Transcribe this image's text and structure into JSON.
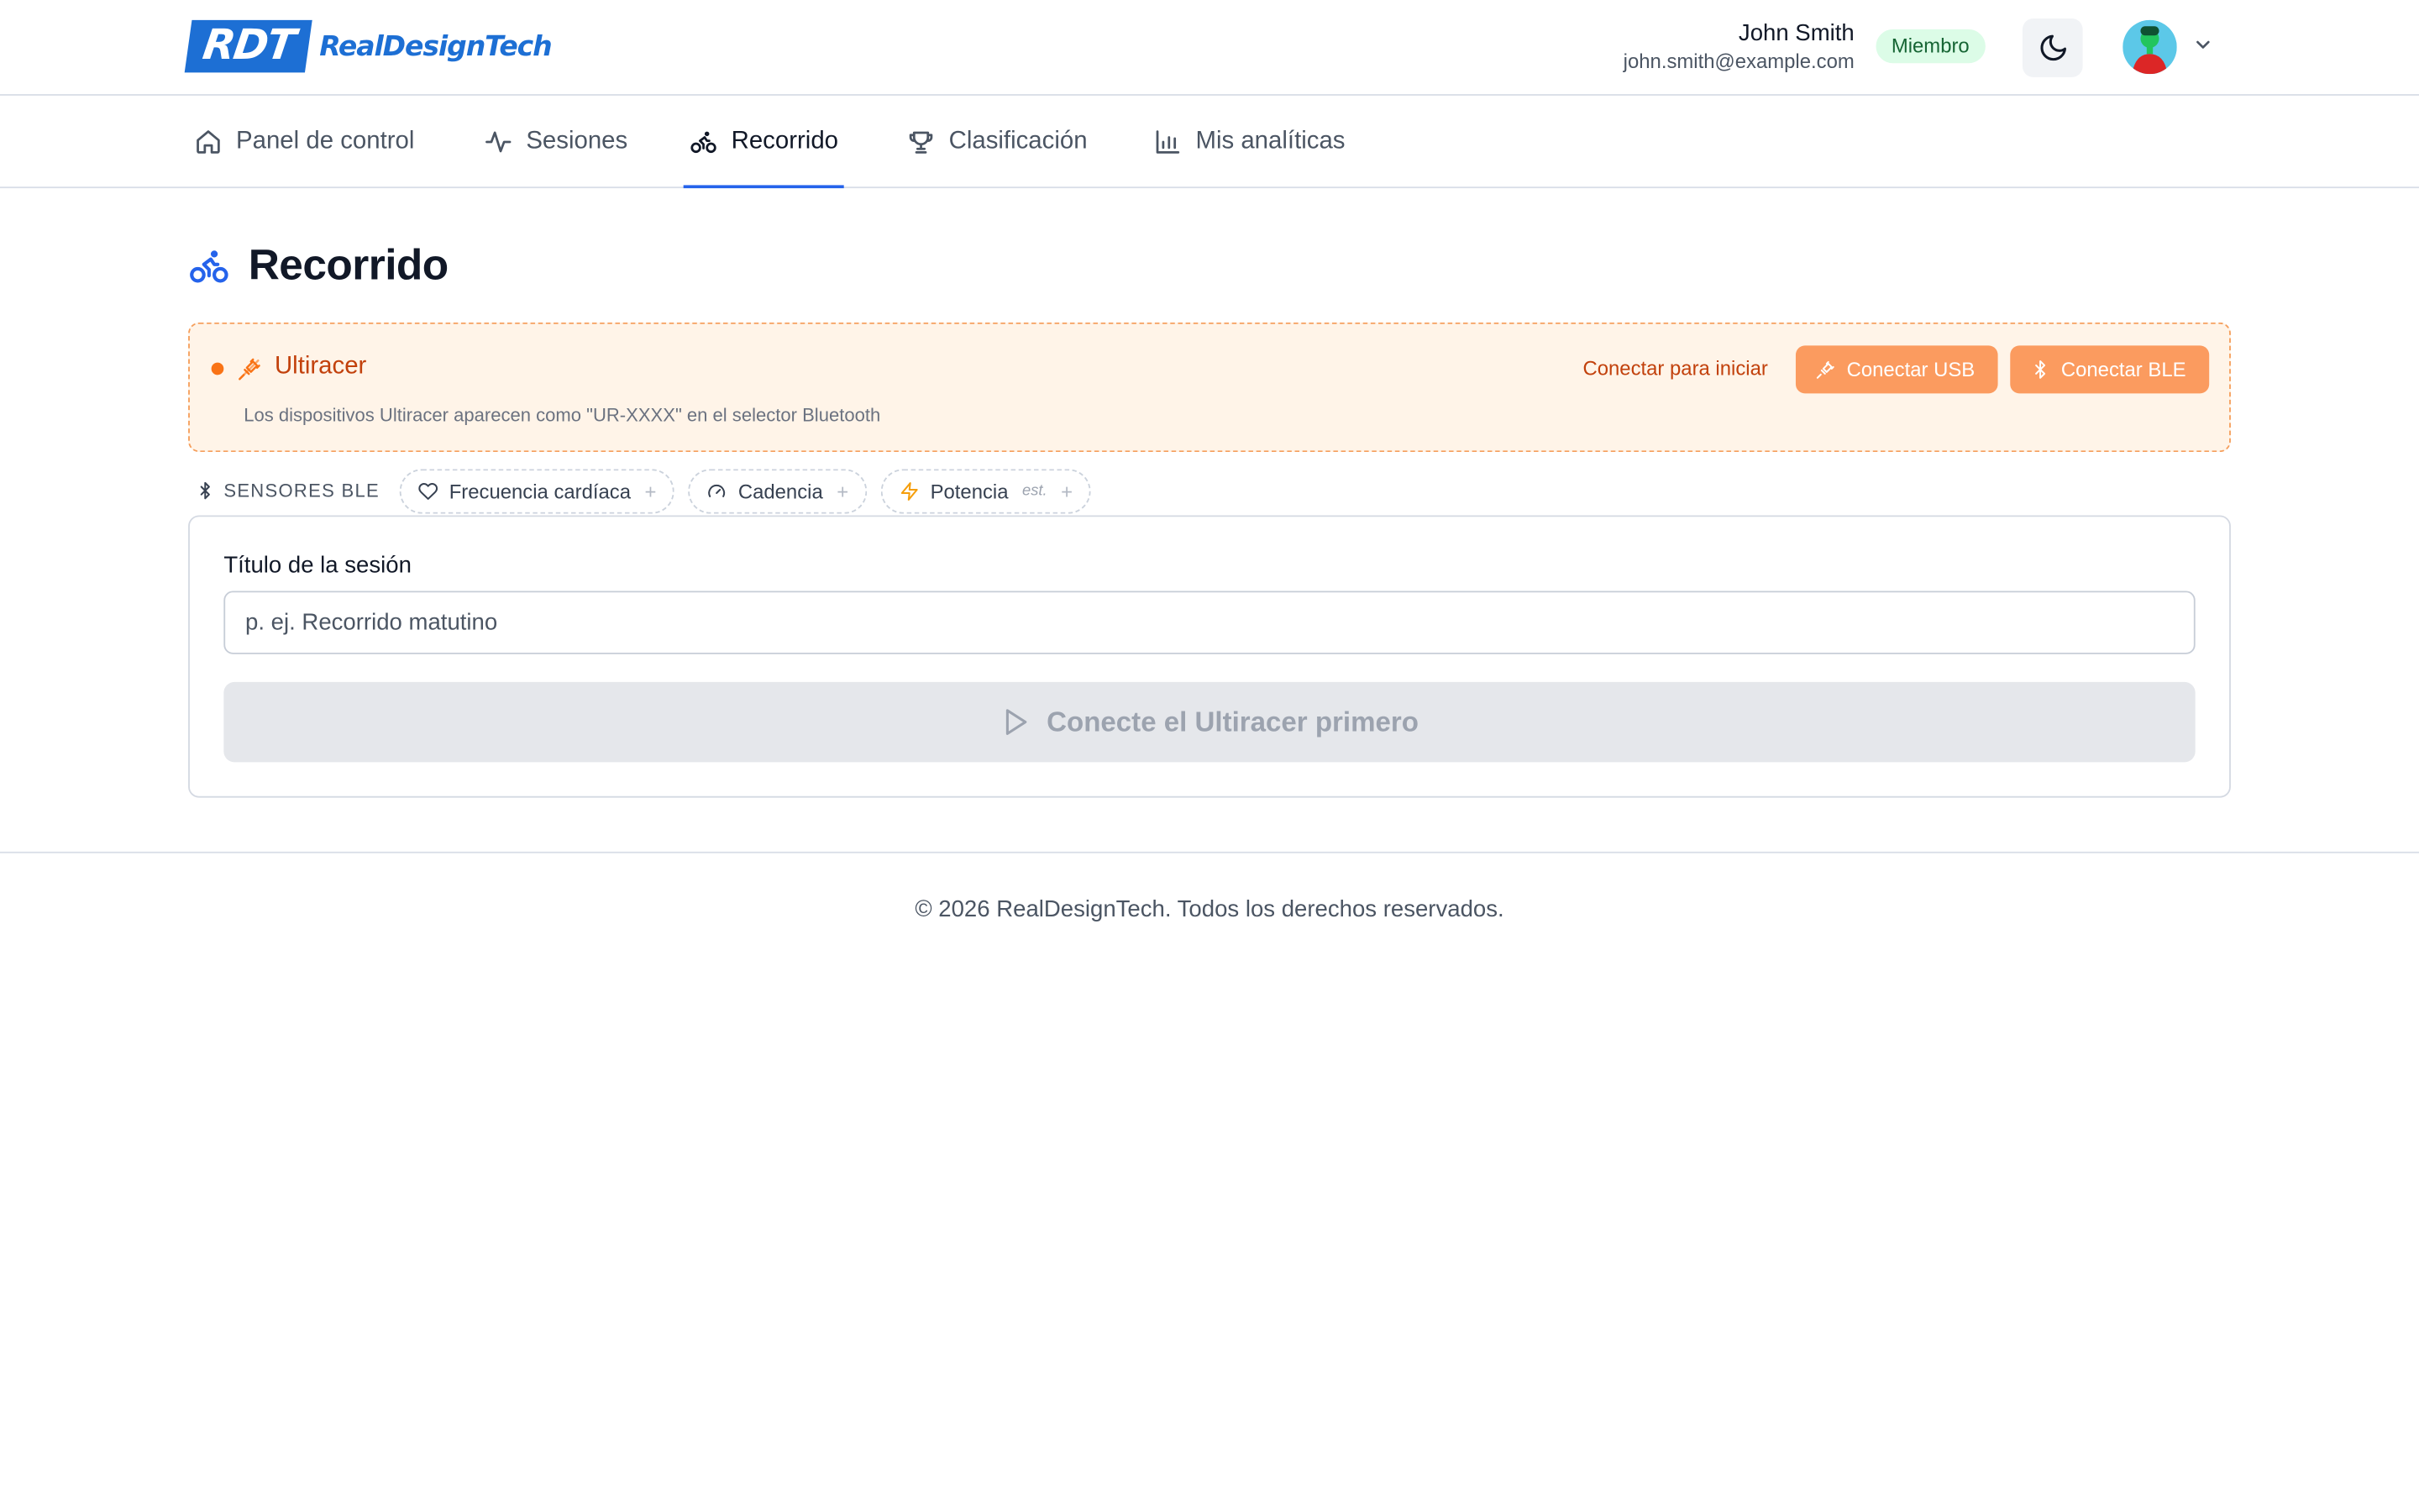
{
  "brand": {
    "mark": "RDT",
    "name": "RealDesignTech",
    "color": "#1d6fd4"
  },
  "user": {
    "name": "John Smith",
    "email": "john.smith@example.com",
    "role": "Miembro"
  },
  "header_icons": {
    "theme_toggle": "moon-icon",
    "avatar": "avatar-icon",
    "menu": "chevron-down-icon"
  },
  "nav": {
    "items": [
      {
        "label": "Panel de control",
        "icon": "home-icon",
        "active": false
      },
      {
        "label": "Sesiones",
        "icon": "activity-icon",
        "active": false
      },
      {
        "label": "Recorrido",
        "icon": "bike-icon",
        "active": true
      },
      {
        "label": "Clasificación",
        "icon": "trophy-icon",
        "active": false
      },
      {
        "label": "Mis analíticas",
        "icon": "bar-chart-icon",
        "active": false
      }
    ],
    "active_color": "#2563eb"
  },
  "page": {
    "title": "Recorrido",
    "title_icon": "bike-icon"
  },
  "device": {
    "name": "Ultiracer",
    "hint": "Los dispositivos Ultiracer aparecen como \"UR-XXXX\" en el selector Bluetooth",
    "status": "Conectar para iniciar",
    "usb_button": "Conectar USB",
    "ble_button": "Conectar BLE",
    "accent_color": "#f97316"
  },
  "sensors": {
    "label": "SENSORES BLE",
    "items": [
      {
        "label": "Frecuencia cardíaca",
        "icon": "heart-icon",
        "suffix": "",
        "add": "+"
      },
      {
        "label": "Cadencia",
        "icon": "gauge-icon",
        "suffix": "",
        "add": "+"
      },
      {
        "label": "Potencia",
        "icon": "zap-icon",
        "suffix": "est.",
        "add": "+"
      }
    ]
  },
  "session": {
    "field_label": "Título de la sesión",
    "placeholder": "p. ej. Recorrido matutino",
    "value": "",
    "start_button": "Conecte el Ultiracer primero",
    "start_disabled": true
  },
  "footer": {
    "copyright": "© 2026 RealDesignTech. Todos los derechos reservados."
  }
}
